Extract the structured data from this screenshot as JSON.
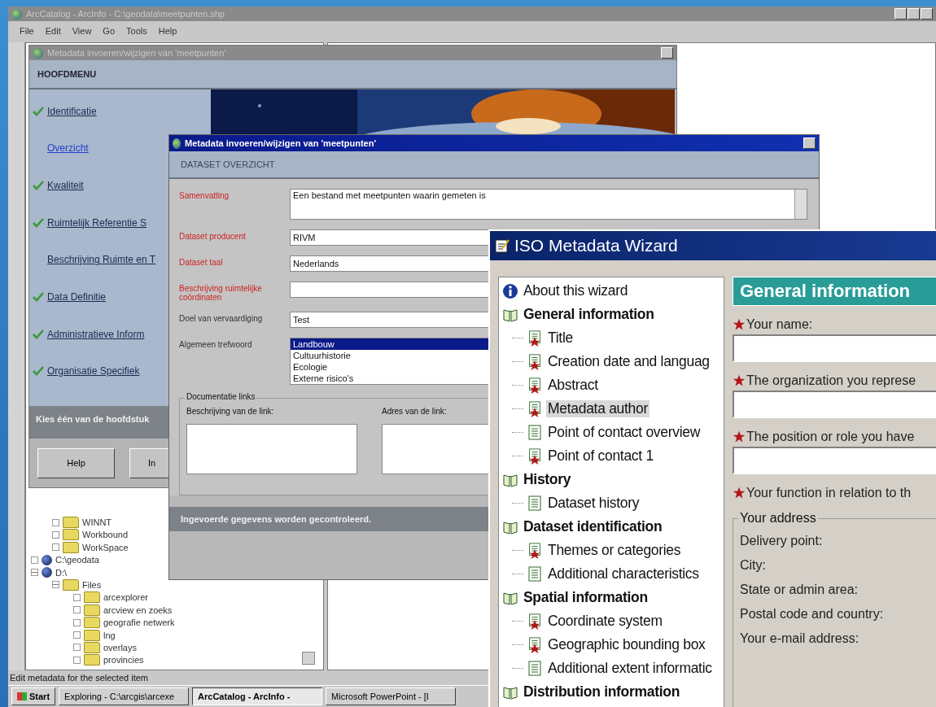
{
  "arccatalog": {
    "title": "ArcCatalog - ArcInfo - C:\\geodata\\meetpunten.shp",
    "active": false,
    "menu": [
      "File",
      "Edit",
      "View",
      "Go",
      "Tools",
      "Help"
    ],
    "tree": [
      {
        "children": [
          {
            "label": "WINNT",
            "expanded": false,
            "kind": "folder"
          },
          {
            "label": "Workbound",
            "expanded": false,
            "kind": "folder"
          },
          {
            "label": "WorkSpace",
            "expanded": false,
            "kind": "folder"
          }
        ]
      },
      {
        "label": "C:\\geodata",
        "expanded": false,
        "kind": "drive"
      },
      {
        "label": "D:\\",
        "expanded": true,
        "kind": "drive",
        "children": [
          {
            "label": "Files",
            "expanded": true,
            "kind": "folder",
            "children": [
              {
                "label": "arcexplorer",
                "expanded": false,
                "kind": "folder"
              },
              {
                "label": "arcview en zoeks",
                "expanded": false,
                "kind": "folder"
              },
              {
                "label": "geografie netwerk",
                "expanded": false,
                "kind": "folder"
              },
              {
                "label": "lng",
                "expanded": false,
                "kind": "folder"
              },
              {
                "label": "overlays",
                "expanded": false,
                "kind": "folder"
              },
              {
                "label": "provincies",
                "expanded": false,
                "kind": "folder"
              }
            ]
          }
        ]
      }
    ],
    "status": "Edit metadata for the selected item",
    "taskbar": {
      "start": "Start",
      "tasks": [
        {
          "label": "Exploring - C:\\arcgis\\arcexe",
          "selected": false
        },
        {
          "label": "ArcCatalog - ArcInfo -",
          "selected": true
        },
        {
          "label": "Microsoft PowerPoint - [I",
          "selected": false
        }
      ]
    }
  },
  "hoofdmenu": {
    "title": "Metadata invoeren/wijzigen van 'meetpunten'",
    "active": false,
    "heading": "HOOFDMENU",
    "items": [
      {
        "label": "Identificatie",
        "checked": true,
        "selected": false
      },
      {
        "label": "Overzicht",
        "checked": false,
        "selected": true
      },
      {
        "label": "Kwaliteit",
        "checked": true,
        "selected": false
      },
      {
        "label": "Ruimtelijk Referentie S",
        "checked": true,
        "selected": false
      },
      {
        "label": "Beschrijving Ruimte en T",
        "checked": false,
        "selected": false
      },
      {
        "label": "Data Definitie",
        "checked": true,
        "selected": false
      },
      {
        "label": "Administratieve Inform",
        "checked": true,
        "selected": false
      },
      {
        "label": "Organisatie Specifiek",
        "checked": true,
        "selected": false
      }
    ],
    "picture": {
      "kind": "picture"
    },
    "prompt": "Kies één van de hoofdstuk",
    "buttons": [
      "Help",
      "In"
    ]
  },
  "dataset_dialog": {
    "title": "Metadata invoeren/wijzigen van 'meetpunten'",
    "active": true,
    "heading": "DATASET OVERZICHT",
    "fields": [
      {
        "label": "Samenvatting",
        "required": true,
        "kind": "textarea",
        "value": "Een bestand met meetpunten waarin gemeten is"
      },
      {
        "label": "Dataset producent",
        "required": true,
        "kind": "text",
        "value": "RIVM"
      },
      {
        "label": "Dataset taal",
        "required": true,
        "kind": "dropdown",
        "value": "Nederlands"
      },
      {
        "label": "Beschrijving ruimtelijke coördinaten",
        "required": true,
        "kind": "dropdown"
      },
      {
        "label": "Doel van vervaardiging",
        "required": false,
        "kind": "text",
        "value": "Test"
      },
      {
        "label": "Algemeen trefwoord",
        "required": false,
        "kind": "list",
        "options": [
          {
            "label": "Landbouw",
            "selected": true
          },
          {
            "label": "Cultuurhistorie",
            "selected": false
          },
          {
            "label": "Ecologie",
            "selected": false
          },
          {
            "label": "Externe risico's",
            "selected": false
          }
        ]
      }
    ],
    "links": {
      "title": "Documentatie links",
      "columns": [
        "Beschrijving van de link:",
        "Adres van de link:"
      ]
    },
    "message": "Ingevoerde gegevens worden gecontroleerd."
  },
  "iso_wizard": {
    "title": "ISO Metadata Wizard",
    "active": true,
    "tree": [
      {
        "label": "About this wizard",
        "kind": "info",
        "selected": false
      },
      {
        "label": "General information",
        "kind": "section",
        "selected": false,
        "children": [
          {
            "label": "Title",
            "kind": "required",
            "selected": false
          },
          {
            "label": "Creation date and languag",
            "kind": "required",
            "selected": false
          },
          {
            "label": "Abstract",
            "kind": "required",
            "selected": false
          },
          {
            "label": "Metadata author",
            "kind": "required",
            "selected": true
          },
          {
            "label": "Point of contact overview",
            "kind": "optional",
            "selected": false
          },
          {
            "label": "Point of contact 1",
            "kind": "required",
            "selected": false
          }
        ]
      },
      {
        "label": "History",
        "kind": "section",
        "selected": false,
        "children": [
          {
            "label": "Dataset history",
            "kind": "optional",
            "selected": false
          }
        ]
      },
      {
        "label": "Dataset identification",
        "kind": "section",
        "selected": false,
        "children": [
          {
            "label": "Themes or categories",
            "kind": "required",
            "selected": false
          },
          {
            "label": "Additional characteristics",
            "kind": "optional",
            "selected": false
          }
        ]
      },
      {
        "label": "Spatial information",
        "kind": "section",
        "selected": false,
        "children": [
          {
            "label": "Coordinate system",
            "kind": "required",
            "selected": false
          },
          {
            "label": "Geographic bounding box",
            "kind": "required",
            "selected": false
          },
          {
            "label": "Additional extent informatic",
            "kind": "optional",
            "selected": false
          }
        ]
      },
      {
        "label": "Distribution information",
        "kind": "section",
        "selected": false
      }
    ],
    "heading": "General information",
    "fields": [
      {
        "label": "Your name:",
        "required": true,
        "kind": "input"
      },
      {
        "label": "The organization you represe",
        "required": true,
        "kind": "input"
      },
      {
        "label": "The position or role you have",
        "required": true,
        "kind": "input"
      },
      {
        "label": "Your function in relation to th",
        "required": true,
        "kind": "label"
      }
    ],
    "address": {
      "title": "Your address",
      "labels": [
        "Delivery point:",
        "City:",
        "State or admin area:",
        "Postal code and country:",
        "Your e-mail address:"
      ]
    }
  }
}
